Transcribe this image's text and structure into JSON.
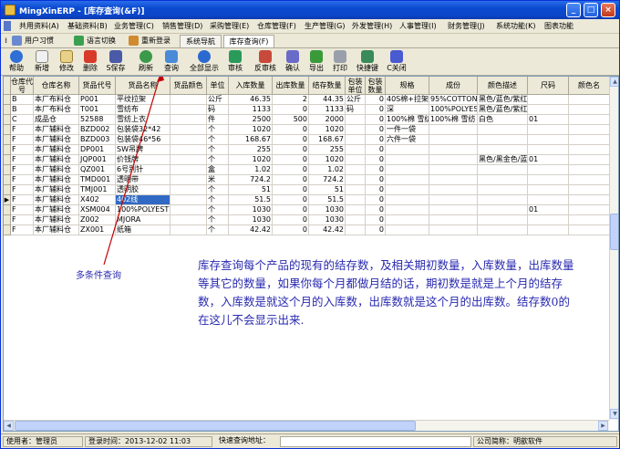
{
  "window": {
    "title": "MingXinERP - [库存查询(&F)]"
  },
  "menu": [
    "共用资料(A)",
    "基础资料(B)",
    "业务管理(C)",
    "销售管理(D)",
    "采购管理(E)",
    "仓库管理(F)",
    "生产管理(G)",
    "外发管理(H)",
    "人事管理(I)",
    "财务管理(J)",
    "系统功能(K)",
    "图表功能"
  ],
  "nav": {
    "user_habit": "用户习惯",
    "language": "语言切换",
    "relogin": "重新登录",
    "tabs": [
      "系统导航",
      "库存查询(F)"
    ]
  },
  "toolbar": [
    "帮助",
    "新增",
    "修改",
    "删除",
    "S保存",
    "刷新",
    "查询",
    "全部显示",
    "审核",
    "反审核",
    "确认",
    "导出",
    "打印",
    "快捷键",
    "C关闭"
  ],
  "columns": [
    "仓库代号",
    "仓库名称",
    "货品代号",
    "货品名称",
    "货品颜色",
    "单位",
    "入库数量",
    "出库数量",
    "结存数量",
    "包装单位",
    "包装数量",
    "规格",
    "成份",
    "颜色描述",
    "尺码",
    "颜色名"
  ],
  "rows": [
    [
      "B",
      "本厂布料仓",
      "P001",
      "平纹拉架",
      "",
      "公斤",
      "46.35",
      "2",
      "44.35",
      "公斤",
      "0",
      "40S棉+拉架",
      "95%COTTON 5%",
      "黑色/蓝色/紫红",
      "",
      ""
    ],
    [
      "B",
      "本厂布料仓",
      "T001",
      "雪纺布",
      "",
      "码",
      "1133",
      "0",
      "1133",
      "码",
      "0",
      "深",
      "100%POLYESTE",
      "黑色/蓝色/紫红",
      "",
      ""
    ],
    [
      "C",
      "成品仓",
      "52588",
      "雪纺上衣",
      "",
      "件",
      "2500",
      "500",
      "2000",
      "",
      "0",
      "100%棉  雪纺",
      "100%棉  雪纺",
      "白色",
      "01",
      ""
    ],
    [
      "F",
      "本厂辅料仓",
      "BZD002",
      "包装袋32*42",
      "",
      "个",
      "1020",
      "0",
      "1020",
      "",
      "0",
      "一件一袋",
      "",
      "",
      "",
      ""
    ],
    [
      "F",
      "本厂辅料仓",
      "BZD003",
      "包装袋46*56",
      "",
      "个",
      "168.67",
      "0",
      "168.67",
      "",
      "0",
      "六件一袋",
      "",
      "",
      "",
      ""
    ],
    [
      "F",
      "本厂辅料仓",
      "DP001",
      "SW吊牌",
      "",
      "个",
      "255",
      "0",
      "255",
      "",
      "0",
      "",
      "",
      "",
      "",
      ""
    ],
    [
      "F",
      "本厂辅料仓",
      "JQP001",
      "价钱牌",
      "",
      "个",
      "1020",
      "0",
      "1020",
      "",
      "0",
      "",
      "",
      "黑色/黑金色/蓝",
      "01",
      ""
    ],
    [
      "F",
      "本厂辅料仓",
      "QZ001",
      "6号别针",
      "",
      "盒",
      "1.02",
      "0",
      "1.02",
      "",
      "0",
      "",
      "",
      "",
      "",
      ""
    ],
    [
      "F",
      "本厂辅料仓",
      "TMD001",
      "透明带",
      "",
      "米",
      "724.2",
      "0",
      "724.2",
      "",
      "0",
      "",
      "",
      "",
      "",
      ""
    ],
    [
      "F",
      "本厂辅料仓",
      "TMJ001",
      "透明胶",
      "",
      "个",
      "51",
      "0",
      "51",
      "",
      "0",
      "",
      "",
      "",
      "",
      ""
    ],
    [
      "F",
      "本厂辅料仓",
      "X402",
      "402线",
      "",
      "个",
      "51.5",
      "0",
      "51.5",
      "",
      "0",
      "",
      "",
      "",
      "",
      ""
    ],
    [
      "F",
      "本厂辅料仓",
      "XSM004",
      "100%POLYESTE",
      "",
      "个",
      "1030",
      "0",
      "1030",
      "",
      "0",
      "",
      "",
      "",
      "01",
      ""
    ],
    [
      "F",
      "本厂辅料仓",
      "Z002",
      "MJORA",
      "",
      "个",
      "1030",
      "0",
      "1030",
      "",
      "0",
      "",
      "",
      "",
      "",
      ""
    ],
    [
      "F",
      "本厂辅料仓",
      "ZX001",
      "纸箱",
      "",
      "个",
      "42.42",
      "0",
      "42.42",
      "",
      "0",
      "",
      "",
      "",
      "",
      ""
    ]
  ],
  "selected_row": 10,
  "annotation": {
    "label": "多条件查询",
    "text": "库存查询每个产品的现有的结存数，及相关期初数量，入库数量，出库数量等其它的数量，如果你每个月都做月结的话，期初数是就是上个月的结存数，入库数是就这个月的入库数，出库数就是这个月的出库数。结存数0的在这儿不会显示出来."
  },
  "status": {
    "user": "使用者：管理员",
    "login_time": "登录时间：2013-12-02 11:03",
    "quick_query": "快速查询地址：",
    "company": "公司简称：明歆软件"
  }
}
